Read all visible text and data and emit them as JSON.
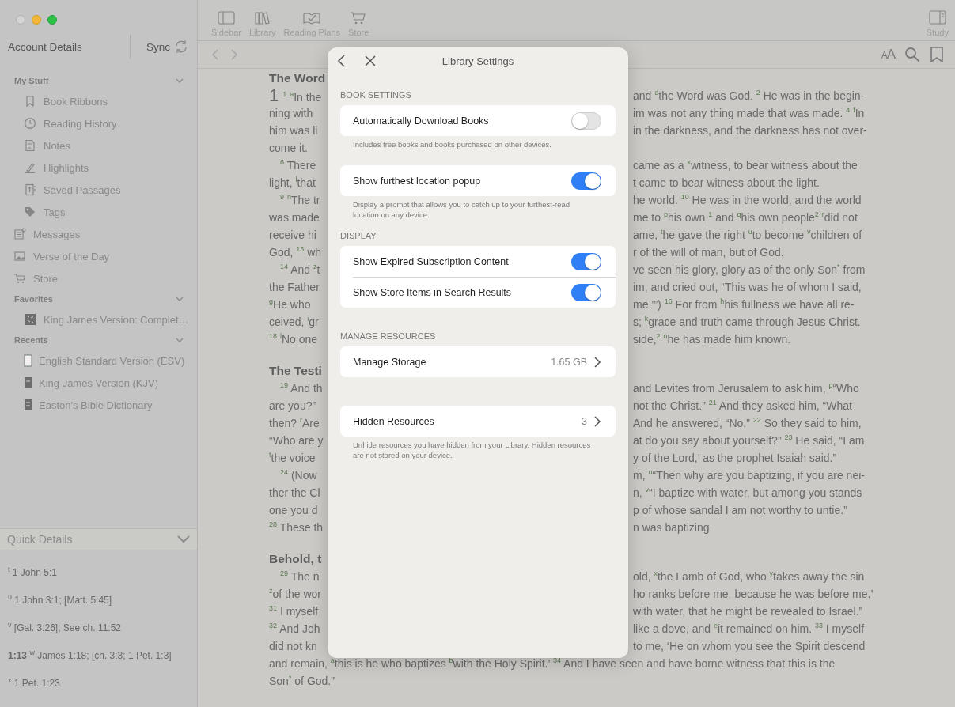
{
  "sidebar": {
    "account": "Account Details",
    "sync": "Sync",
    "tree": [
      {
        "kind": "section",
        "label": "My Stuff",
        "expanded": true,
        "children": [
          {
            "label": "Book Ribbons"
          },
          {
            "label": "Reading History"
          },
          {
            "label": "Notes"
          },
          {
            "label": "Highlights"
          },
          {
            "label": "Saved Passages"
          },
          {
            "label": "Tags"
          }
        ]
      },
      {
        "kind": "link",
        "label": "Messages"
      },
      {
        "kind": "link",
        "label": "Verse of the Day"
      },
      {
        "kind": "link",
        "label": "Store"
      },
      {
        "kind": "section",
        "label": "Favorites",
        "expanded": true,
        "children": [
          {
            "label": "King James Version: Complet…"
          }
        ]
      },
      {
        "kind": "section",
        "label": "Recents",
        "expanded": true,
        "children": [
          {
            "label": "English Standard Version (ESV)"
          },
          {
            "label": "King James Version (KJV)"
          },
          {
            "label": "Easton's Bible Dictionary"
          }
        ]
      }
    ],
    "quick_details": {
      "title": "Quick Details",
      "expanded": true,
      "notes": [
        {
          "text": "$^{t}$ 1 John 5:1"
        },
        {
          "text": "$^{u}$ 1 John 3:1; [Matt. 5:45]"
        },
        {
          "text": "$^{v}$ [Gal. 3:26]; See ch. 11:52"
        },
        {
          "text": "**1:13** $^{w}$ James 1:18; [ch. 3:3; 1 Pet. 1:3]"
        },
        {
          "text": "$^{x}$ 1 Pet. 1:23"
        }
      ]
    }
  },
  "toolbar": {
    "buttons": [
      {
        "label": "Sidebar"
      },
      {
        "label": "Library"
      },
      {
        "label": "Reading Plans"
      },
      {
        "label": "Store"
      }
    ],
    "study": "Study"
  },
  "navbar": {
    "text_size": "AA"
  },
  "reading": {
    "sections": [
      {
        "heading": "The Word",
        "lines": [
          {
            "kind": "split",
            "chapter": "1",
            "left": "$^{1}$ $^{a}$In the",
            "right": "and $^{d}$the Word was God. $^{2}$ He was in the begin-"
          },
          {
            "kind": "split",
            "left": "ning with",
            "right": "im was not any thing made that was made. $^{4}$ $^{f}$In"
          },
          {
            "kind": "split",
            "left": "him was li",
            "right": "in the darkness, and the darkness has not over-"
          },
          {
            "kind": "split",
            "left": "come it."
          },
          {
            "kind": "split",
            "indent": true,
            "left": "$^{6}$ There",
            "right": "came as a $^{k}$witness, to bear witness about the"
          },
          {
            "kind": "split",
            "left": "light, $^{l}$that",
            "right": "t came to bear witness about the light."
          },
          {
            "kind": "split",
            "indent": true,
            "left": "$^{9}$ $^{n}$The tr",
            "right": "he world. $^{10}$ He was in the world, and the world"
          },
          {
            "kind": "split",
            "left": "was made",
            "right": "me to $^{p}$his own,$^{1}$ and $^{q}$his own people$^{2}$ $^{r}$did not"
          },
          {
            "kind": "split",
            "left": "receive hi",
            "right": "ame, $^{t}$he gave the right $^{u}$to become $^{v}$children of"
          },
          {
            "kind": "split",
            "left": "God, $^{13}$ wh",
            "right": "r of the will of man, but of God."
          },
          {
            "kind": "split",
            "indent": true,
            "left": "$^{14}$ And $^{z}$t",
            "right": "ve seen his glory, glory as of the only Son$^{*}$ from"
          },
          {
            "kind": "split",
            "left": "the Father",
            "right": "im, and cried out, “This was he of whom I said,"
          },
          {
            "kind": "split",
            "left": "$^{g}$He who",
            "right": "me.’”) $^{16}$ For from $^{h}$his fullness we have all re-"
          },
          {
            "kind": "split",
            "left": "ceived, $^{i}$gr",
            "right": "s; $^{k}$grace and truth came through Jesus Christ."
          },
          {
            "kind": "split",
            "left": "$^{18}$ $^{l}$No one",
            "right": "side,$^{2}$ $^{n}$he has made him known."
          }
        ]
      },
      {
        "heading": "The Testi",
        "lines": [
          {
            "kind": "split",
            "indent": true,
            "left": "$^{19}$ And th",
            "right": "and Levites from Jerusalem to ask him, $^{p}$“Who"
          },
          {
            "kind": "split",
            "left": "are you?”",
            "right": "not the Christ.” $^{21}$ And they asked him, “What"
          },
          {
            "kind": "split",
            "left": "then? $^{r}$Are",
            "right": "And he answered, “No.” $^{22}$ So they said to him,"
          },
          {
            "kind": "split",
            "left": "“Who are y",
            "right": "at do you say about yourself?” $^{23}$ He said, “I am"
          },
          {
            "kind": "split",
            "left": "$^{t}$the voice",
            "right": "y of the Lord,’ as the prophet Isaiah said.”"
          },
          {
            "kind": "split",
            "indent": true,
            "left": "$^{24}$ (Now",
            "right": "m, $^{u}$“Then why are you baptizing, if you are nei-"
          },
          {
            "kind": "split",
            "left": "ther the Cl",
            "right": "n, $^{v}$“I baptize with water, but among you stands"
          },
          {
            "kind": "split",
            "left": "one you d",
            "right": "p of whose sandal I am not worthy to untie.”"
          },
          {
            "kind": "split",
            "left": "$^{28}$ These th",
            "right": "n was baptizing."
          }
        ]
      },
      {
        "heading": "Behold, t",
        "lines": [
          {
            "kind": "split",
            "indent": true,
            "left": "$^{29}$ The n",
            "right": "old, $^{x}$the Lamb of God, who $^{y}$takes away the sin"
          },
          {
            "kind": "split",
            "left": "$^{z}$of the wor",
            "right": "ho ranks before me, because he was before me.’"
          },
          {
            "kind": "split",
            "left": "$^{31}$ I myself",
            "right": "with water, that he might be revealed to Israel.”"
          },
          {
            "kind": "split",
            "left": "$^{32}$ And Joh",
            "right": "like a dove, and $^{e}$it remained on him. $^{33}$ I myself"
          },
          {
            "kind": "split",
            "left": "did not kn",
            "right": "to me, ‘He on whom you see the Spirit descend"
          },
          {
            "kind": "full",
            "text": "and remain, $^{a}$this is he who baptizes $^{b}$with the Holy Spirit.’ $^{34}$ And I have seen and have borne witness that this is the"
          },
          {
            "kind": "full",
            "text": "Son$^{*}$ of God.”"
          }
        ]
      }
    ]
  },
  "dialog": {
    "title": "Library Settings",
    "sections": [
      {
        "title": "BOOK SETTINGS",
        "groups": [
          {
            "rows": [
              {
                "kind": "toggle",
                "label": "Automatically Download Books",
                "on": false
              }
            ],
            "note": "Includes free books and books purchased on other devices."
          },
          {
            "rows": [
              {
                "kind": "toggle",
                "label": "Show furthest location popup",
                "on": true
              }
            ],
            "note": "Display a prompt that allows you to catch up to your furthest-read location on any device."
          }
        ]
      },
      {
        "title": "DISPLAY",
        "groups": [
          {
            "rows": [
              {
                "kind": "toggle",
                "label": "Show Expired Subscription Content",
                "on": true
              },
              {
                "kind": "toggle",
                "label": "Show Store Items in Search Results",
                "on": true
              }
            ]
          }
        ]
      },
      {
        "title": "MANAGE RESOURCES",
        "groups": [
          {
            "rows": [
              {
                "kind": "link",
                "label": "Manage Storage",
                "value": "1.65 GB"
              }
            ]
          },
          {
            "rows": [
              {
                "kind": "link",
                "label": "Hidden Resources",
                "value": "3"
              }
            ],
            "note": "Unhide resources you have hidden from your Library. Hidden resources are not stored on your device."
          }
        ]
      }
    ]
  }
}
